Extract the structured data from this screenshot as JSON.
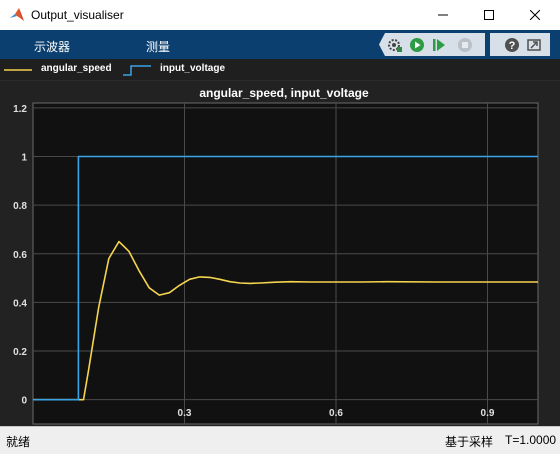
{
  "window": {
    "title": "Output_visualiser"
  },
  "toolstrip": {
    "tabs": [
      "示波器",
      "测量"
    ]
  },
  "toolbar_icons": [
    "settings-icon",
    "run-icon",
    "step-forward-icon",
    "stop-icon",
    "help-icon",
    "undock-icon"
  ],
  "legend": [
    {
      "label": "angular_speed",
      "color": "#f5d44f"
    },
    {
      "label": "input_voltage",
      "color": "#3ba4e6"
    }
  ],
  "status": {
    "left": "就绪",
    "mode": "基于采样",
    "time": "T=1.0000"
  },
  "chart_data": {
    "type": "line",
    "title": "angular_speed, input_voltage",
    "xlim": [
      0,
      1
    ],
    "ylim": [
      -0.1,
      1.22
    ],
    "xticks": [
      0.3,
      0.6,
      0.9
    ],
    "xtick_labels": [
      "0.3",
      "0.6",
      "0.9"
    ],
    "yticks": [
      0,
      0.2,
      0.4,
      0.6,
      0.8,
      1,
      1.2
    ],
    "ytick_labels": [
      "0",
      "0.2",
      "0.4",
      "0.6",
      "0.8",
      "1",
      "1.2"
    ],
    "grid": true,
    "series": [
      {
        "name": "angular_speed",
        "color": "#f5d44f",
        "x": [
          0,
          0.09,
          0.1,
          0.11,
          0.13,
          0.15,
          0.17,
          0.19,
          0.21,
          0.23,
          0.25,
          0.27,
          0.29,
          0.31,
          0.33,
          0.35,
          0.37,
          0.39,
          0.41,
          0.43,
          0.45,
          0.48,
          0.51,
          0.55,
          0.6,
          0.65,
          0.7,
          0.8,
          0.9,
          1.0
        ],
        "y": [
          0,
          0,
          0,
          0.12,
          0.38,
          0.58,
          0.65,
          0.61,
          0.53,
          0.46,
          0.43,
          0.44,
          0.47,
          0.495,
          0.505,
          0.503,
          0.495,
          0.485,
          0.48,
          0.478,
          0.48,
          0.483,
          0.485,
          0.484,
          0.484,
          0.484,
          0.485,
          0.484,
          0.484,
          0.484
        ]
      },
      {
        "name": "input_voltage",
        "color": "#3ba4e6",
        "x": [
          0,
          0.09,
          0.09,
          1.0
        ],
        "y": [
          0,
          0,
          1,
          1
        ]
      }
    ]
  }
}
